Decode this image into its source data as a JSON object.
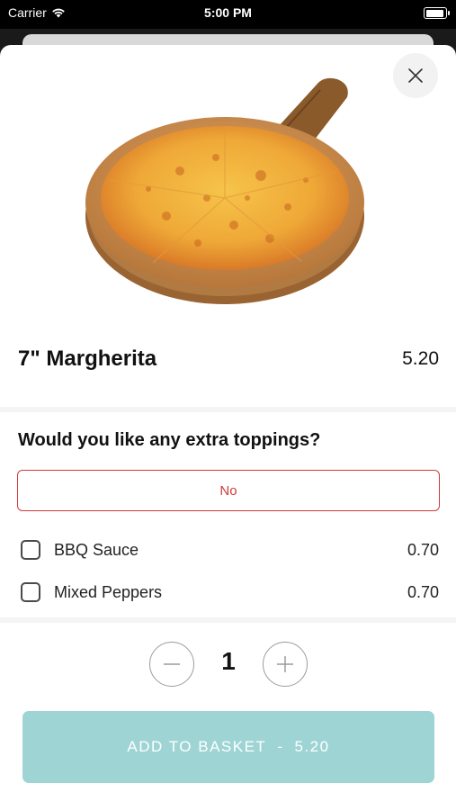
{
  "status_bar": {
    "carrier": "Carrier",
    "time": "5:00 PM"
  },
  "product": {
    "name": "7\" Margherita",
    "price": "5.20"
  },
  "toppings": {
    "question": "Would you like any extra toppings?",
    "no_label": "No",
    "options": [
      {
        "label": "BBQ Sauce",
        "price": "0.70",
        "checked": false
      },
      {
        "label": "Mixed Peppers",
        "price": "0.70",
        "checked": false
      }
    ]
  },
  "quantity": {
    "value": "1"
  },
  "add_to_basket": {
    "label": "ADD TO BASKET",
    "separator": "-",
    "price": "5.20"
  },
  "colors": {
    "accent_red": "#d0393c",
    "button_teal": "#9fd4d5"
  },
  "icons": [
    "wifi-icon",
    "battery-icon",
    "close-icon",
    "pizza-image",
    "minus-icon",
    "plus-icon"
  ]
}
